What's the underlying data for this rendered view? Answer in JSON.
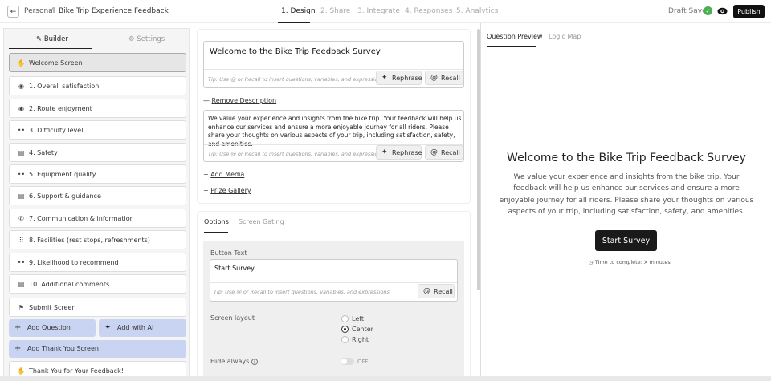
{
  "header": {
    "breadcrumb_root": "Personal",
    "breadcrumb_sep": "/",
    "survey_title": "Bike Trip Experience Feedback",
    "steps": [
      "1. Design",
      "2. Share",
      "3. Integrate",
      "4. Responses",
      "5. Analytics"
    ],
    "active_step": "1. Design",
    "status": "Draft Saved",
    "publish_label": "Publish"
  },
  "left": {
    "tabs": {
      "builder": "Builder",
      "settings": "Settings"
    },
    "items": [
      {
        "label": "Welcome Screen",
        "icon": "hand-wave-icon"
      },
      {
        "label": "1. Overall satisfaction",
        "icon": "radio-icon"
      },
      {
        "label": "2. Route enjoyment",
        "icon": "radio-icon"
      },
      {
        "label": "3. Difficulty level",
        "icon": "dots-scale-icon"
      },
      {
        "label": "4. Safety",
        "icon": "list-icon"
      },
      {
        "label": "5. Equipment quality",
        "icon": "dots-scale-icon"
      },
      {
        "label": "6. Support & guidance",
        "icon": "list-icon"
      },
      {
        "label": "7. Communication & information",
        "icon": "phone-icon"
      },
      {
        "label": "8. Facilities (rest stops, refreshments)",
        "icon": "grid-icon"
      },
      {
        "label": "9. Likelihood to recommend",
        "icon": "dots-scale-icon"
      },
      {
        "label": "10. Additional comments",
        "icon": "list-icon"
      },
      {
        "label": "Submit Screen",
        "icon": "flag-icon"
      }
    ],
    "add_question": "Add Question",
    "add_with_ai": "Add with AI",
    "add_thank_you": "Add Thank You Screen",
    "thank_you_item": "Thank You for Your Feedback!"
  },
  "editor": {
    "title_value": "Welcome to the Bike Trip Feedback Survey",
    "hint": "Tip: Use @ or Recall to insert questions, variables, and expressions.",
    "rephrase": "Rephrase",
    "recall": "Recall",
    "remove_description": "Remove Description",
    "description_value": "We value your experience and insights from the bike trip. Your feedback will help us enhance our services and ensure a more enjoyable journey for all riders. Please share your thoughts on various aspects of your trip, including satisfaction, safety, and amenities.",
    "add_media": "Add Media",
    "prize_gallery": "Prize Gallery"
  },
  "options": {
    "tabs": [
      "Options",
      "Screen Gating"
    ],
    "button_text_label": "Button Text",
    "button_text_value": "Start Survey",
    "hint": "Tip: Use @ or Recall to insert questions, variables, and expressions.",
    "recall": "Recall",
    "screen_layout_label": "Screen layout",
    "layouts": [
      "Left",
      "Center",
      "Right"
    ],
    "selected_layout": "Center",
    "hide_always_label": "Hide always",
    "hide_always_state": "OFF"
  },
  "preview": {
    "tabs": [
      "Question Preview",
      "Logic Map"
    ],
    "title": "Welcome to the Bike Trip Feedback Survey",
    "description": "We value your experience and insights from the bike trip. Your feedback will help us enhance our services and ensure a more enjoyable journey for all riders. Please share your thoughts on various aspects of your trip, including satisfaction, safety, and amenities.",
    "start_button": "Start Survey",
    "time_note": "Time to complete: X minutes"
  }
}
